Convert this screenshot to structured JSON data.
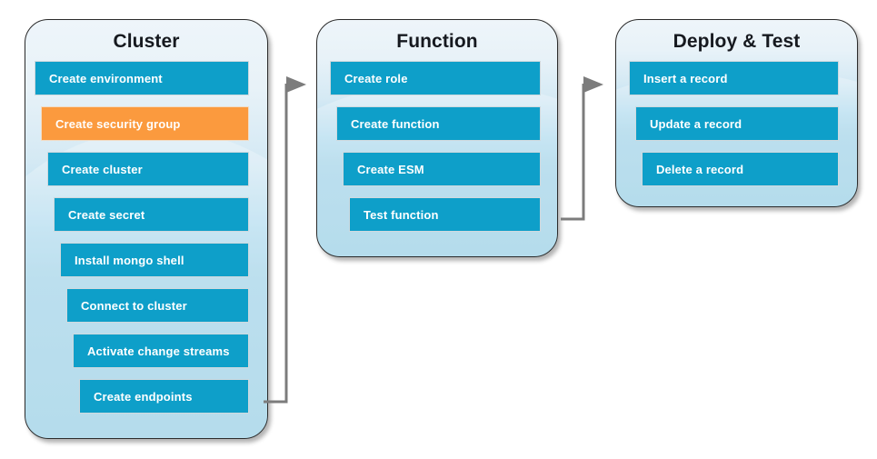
{
  "diagram": {
    "title_visible": false,
    "colors": {
      "step_blue": "#0e9fc9",
      "step_highlight_orange": "#fb9a3e",
      "panel_top": "#eef5fa",
      "panel_bottom": "#9bd0e6",
      "panel_border": "#2b2b2b",
      "connector_gray": "#7c7c7c",
      "step_text": "#ffffff",
      "title_text": "#16191f"
    },
    "panels": [
      {
        "id": "cluster",
        "title": "Cluster",
        "steps": [
          {
            "label": "Create environment",
            "state": "normal"
          },
          {
            "label": "Create security group",
            "state": "highlight"
          },
          {
            "label": "Create cluster",
            "state": "normal"
          },
          {
            "label": "Create secret",
            "state": "normal"
          },
          {
            "label": "Install mongo shell",
            "state": "normal"
          },
          {
            "label": "Connect to cluster",
            "state": "normal"
          },
          {
            "label": "Activate change streams",
            "state": "normal"
          },
          {
            "label": "Create endpoints",
            "state": "normal"
          }
        ]
      },
      {
        "id": "function",
        "title": "Function",
        "steps": [
          {
            "label": "Create role",
            "state": "normal"
          },
          {
            "label": "Create function",
            "state": "normal"
          },
          {
            "label": "Create ESM",
            "state": "normal"
          },
          {
            "label": "Test function",
            "state": "normal"
          }
        ]
      },
      {
        "id": "deploy-test",
        "title": "Deploy & Test",
        "steps": [
          {
            "label": "Insert a record",
            "state": "normal"
          },
          {
            "label": "Update a record",
            "state": "normal"
          },
          {
            "label": "Delete a record",
            "state": "normal"
          }
        ]
      }
    ],
    "connectors": [
      {
        "id": "cluster-to-function",
        "from": "cluster",
        "to": "function",
        "direction": "right"
      },
      {
        "id": "function-to-deploy",
        "from": "function",
        "to": "deploy-test",
        "direction": "right"
      }
    ]
  }
}
